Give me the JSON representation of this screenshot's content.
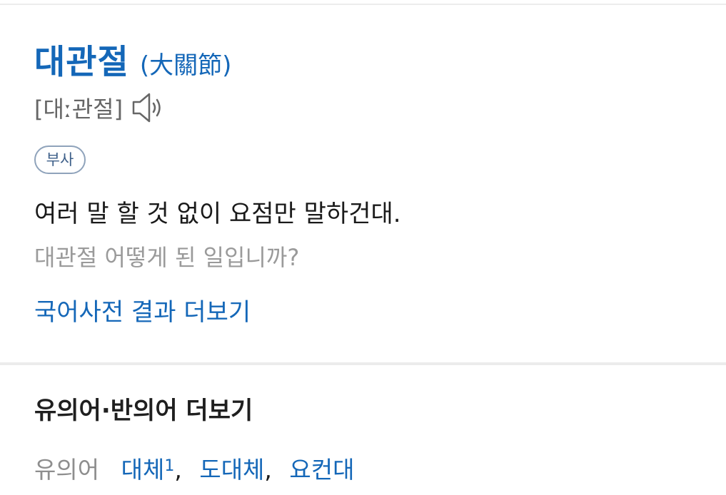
{
  "entry": {
    "headword": "대관절",
    "hanja": "(大關節)",
    "pronunciation": "[대ː관절]",
    "audio_icon": "speaker-icon",
    "part_of_speech": "부사",
    "definition": "여러 말 할 것 없이 요점만 말하건대.",
    "example": "대관절 어떻게 된 일입니까?",
    "more_link": "국어사전 결과 더보기"
  },
  "synonyms": {
    "header": "유의어·반의어 더보기",
    "label": "유의어",
    "items": [
      {
        "word": "대체",
        "sup": "1",
        "sep": ","
      },
      {
        "word": "도대체",
        "sup": "",
        "sep": ","
      },
      {
        "word": "요컨대",
        "sup": "",
        "sep": ""
      }
    ]
  },
  "colors": {
    "accent": "#1467b8",
    "text": "#1a1a1a",
    "muted": "#9a9a9a",
    "divider": "#ececec"
  }
}
